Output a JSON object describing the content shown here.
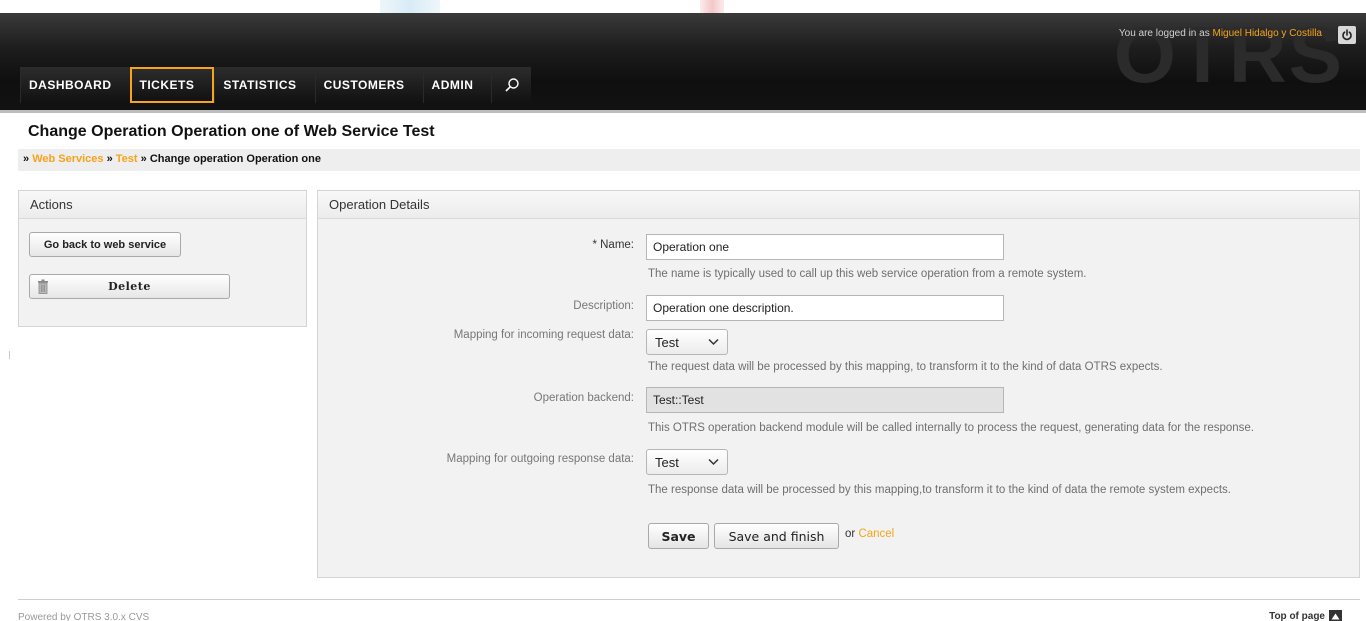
{
  "header": {
    "logo": "OTRS",
    "login_prefix": "You are logged in as",
    "user_name": "Miguel Hidalgo y Costilla",
    "logout_icon": "power-icon"
  },
  "nav": {
    "items": [
      {
        "label": "DASHBOARD"
      },
      {
        "label": "TICKETS"
      },
      {
        "label": "STATISTICS"
      },
      {
        "label": "CUSTOMERS"
      },
      {
        "label": "ADMIN"
      }
    ],
    "active": "TICKETS",
    "search_icon": "search-icon"
  },
  "page": {
    "title": "Change Operation Operation one of Web Service Test",
    "breadcrumb": {
      "sep": "»",
      "items": [
        {
          "label": "Web Services",
          "link": true
        },
        {
          "label": "Test",
          "link": true
        },
        {
          "label": "Change operation Operation one",
          "link": false
        }
      ]
    }
  },
  "actions": {
    "heading": "Actions",
    "back_button": "Go back to web service",
    "delete_button": "Delete",
    "delete_icon": "trash-icon"
  },
  "details": {
    "heading": "Operation Details",
    "name_label": "* Name:",
    "name_value": "Operation one",
    "name_hint": "The name is typically used to call up this web service operation from a remote system.",
    "description_label": "Description:",
    "description_value": "Operation one description.",
    "incoming_label": "Mapping for incoming request data:",
    "incoming_value": "Test",
    "incoming_hint": "The request data will be processed by this mapping, to transform it to the kind of data OTRS expects.",
    "backend_label": "Operation backend:",
    "backend_value": "Test::Test",
    "backend_hint": "This OTRS operation backend module will be called internally to process the request, generating data for the response.",
    "outgoing_label": "Mapping for outgoing response data:",
    "outgoing_value": "Test",
    "outgoing_hint": "The response data will be processed by this mapping,to  transform it to the kind of data the remote system expects.",
    "save_button": "Save",
    "save_finish_button": "Save and finish",
    "or_text": "or",
    "cancel_link": "Cancel"
  },
  "footer": {
    "powered": "Powered by OTRS 3.0.x CVS",
    "top_of_page": "Top of page"
  }
}
